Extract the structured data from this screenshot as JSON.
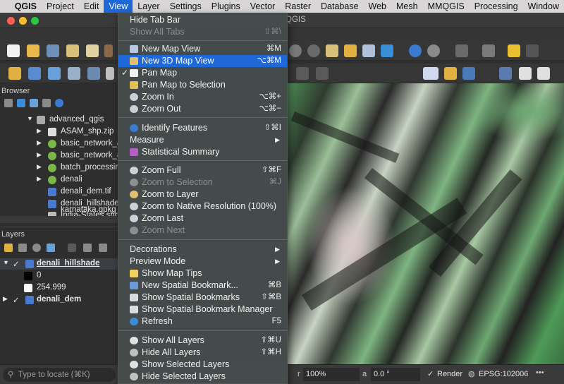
{
  "menubar": {
    "app": "QGIS",
    "items": [
      "Project",
      "Edit",
      "View",
      "Layer",
      "Settings",
      "Plugins",
      "Vector",
      "Raster",
      "Database",
      "Web",
      "Mesh",
      "MMQGIS",
      "Processing",
      "Window"
    ]
  },
  "window_title": "QGIS",
  "browser": {
    "title": "Browser",
    "items": [
      "advanced_qgis",
      "ASAM_shp.zip",
      "basic_network_a",
      "basic_network_a",
      "batch_processin",
      "denali",
      "denali_dem.tif",
      "denali_hillshade.",
      "India-States.shp",
      "karnataka.gpkg"
    ]
  },
  "layers": {
    "title": "Layers",
    "items": [
      {
        "name": "denali_hillshade",
        "checked": true
      },
      {
        "name": "0"
      },
      {
        "name": "254.999"
      },
      {
        "name": "denali_dem",
        "checked": true
      }
    ]
  },
  "view_menu": {
    "items": [
      {
        "label": "Hide Tab Bar",
        "shortcut": "",
        "enabled": true
      },
      {
        "label": "Show All Tabs",
        "shortcut": "⇧⌘\\",
        "enabled": false
      },
      {
        "label": "New Map View",
        "shortcut": "⌘M",
        "enabled": true,
        "icon": "map-view-icon"
      },
      {
        "label": "New 3D Map View",
        "shortcut": "⌥⌘M",
        "enabled": true,
        "highlighted": true,
        "icon": "3d-map-icon"
      },
      {
        "label": "Pan Map",
        "shortcut": "",
        "enabled": true,
        "checked": true,
        "icon": "hand-icon"
      },
      {
        "label": "Pan Map to Selection",
        "shortcut": "",
        "enabled": true,
        "icon": "pan-selection-icon"
      },
      {
        "label": "Zoom In",
        "shortcut": "⌥⌘+",
        "enabled": true,
        "icon": "zoom-in-icon"
      },
      {
        "label": "Zoom Out",
        "shortcut": "⌥⌘−",
        "enabled": true,
        "icon": "zoom-out-icon"
      },
      {
        "label": "Identify Features",
        "shortcut": "⇧⌘I",
        "enabled": true,
        "icon": "identify-icon"
      },
      {
        "label": "Measure",
        "shortcut": "",
        "enabled": true,
        "submenu": true
      },
      {
        "label": "Statistical Summary",
        "shortcut": "",
        "enabled": true,
        "icon": "sigma-icon"
      },
      {
        "label": "Zoom Full",
        "shortcut": "⇧⌘F",
        "enabled": true,
        "icon": "zoom-full-icon"
      },
      {
        "label": "Zoom to Selection",
        "shortcut": "⌘J",
        "enabled": false,
        "icon": "zoom-selection-icon"
      },
      {
        "label": "Zoom to Layer",
        "shortcut": "",
        "enabled": true,
        "icon": "zoom-layer-icon"
      },
      {
        "label": "Zoom to Native Resolution (100%)",
        "shortcut": "",
        "enabled": true,
        "icon": "zoom-native-icon"
      },
      {
        "label": "Zoom Last",
        "shortcut": "",
        "enabled": true,
        "icon": "zoom-last-icon"
      },
      {
        "label": "Zoom Next",
        "shortcut": "",
        "enabled": false,
        "icon": "zoom-next-icon"
      },
      {
        "label": "Decorations",
        "shortcut": "",
        "enabled": true,
        "submenu": true
      },
      {
        "label": "Preview Mode",
        "shortcut": "",
        "enabled": true,
        "submenu": true
      },
      {
        "label": "Show Map Tips",
        "shortcut": "",
        "enabled": true,
        "icon": "map-tips-icon"
      },
      {
        "label": "New Spatial Bookmark...",
        "shortcut": "⌘B",
        "enabled": true,
        "icon": "bookmark-add-icon"
      },
      {
        "label": "Show Spatial Bookmarks",
        "shortcut": "⇧⌘B",
        "enabled": true,
        "icon": "bookmarks-icon"
      },
      {
        "label": "Show Spatial Bookmark Manager",
        "shortcut": "",
        "enabled": true,
        "icon": "bookmark-manager-icon"
      },
      {
        "label": "Refresh",
        "shortcut": "F5",
        "enabled": true,
        "icon": "refresh-icon"
      },
      {
        "label": "Show All Layers",
        "shortcut": "⇧⌘U",
        "enabled": true,
        "icon": "show-layers-icon"
      },
      {
        "label": "Hide All Layers",
        "shortcut": "⇧⌘H",
        "enabled": true,
        "icon": "hide-layers-icon"
      },
      {
        "label": "Show Selected Layers",
        "shortcut": "",
        "enabled": true,
        "icon": "show-selected-icon"
      },
      {
        "label": "Hide Selected Layers",
        "shortcut": "",
        "enabled": true,
        "icon": "hide-selected-icon"
      }
    ]
  },
  "status": {
    "search_placeholder": "Type to locate (⌘K)",
    "magnifier": "100%",
    "rotation": "0.0 °",
    "render_label": "Render",
    "crs": "EPSG:102006"
  },
  "colors": {
    "accent": "#1f68d8"
  }
}
